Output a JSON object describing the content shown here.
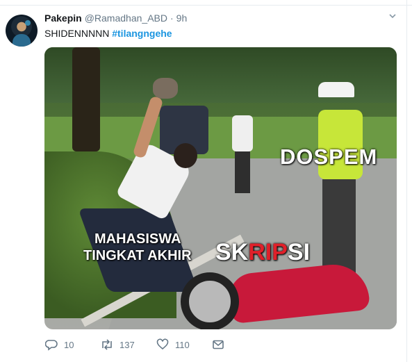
{
  "tweet": {
    "author": {
      "display_name": "Pakepin",
      "handle": "@Ramadhan_ABD",
      "separator": "·",
      "time": "9h"
    },
    "text_plain": "SHIDENNNNN",
    "hashtag": "#tilangngehe",
    "menu_icon": "chevron-down-icon"
  },
  "media": {
    "caption_dospem": "DOSPEM",
    "caption_mahasiswa_line1": "MAHASISWA",
    "caption_mahasiswa_line2": "TINGKAT AKHIR",
    "caption_skripsi_a": "SK",
    "caption_skripsi_b": "RIP",
    "caption_skripsi_c": "SI",
    "caption_colors": {
      "text": "#ffffff",
      "accent": "#e0202a"
    }
  },
  "actions": {
    "reply": {
      "icon": "reply-icon",
      "count": "10"
    },
    "retweet": {
      "icon": "retweet-icon",
      "count": "137"
    },
    "like": {
      "icon": "heart-icon",
      "count": "110"
    },
    "message": {
      "icon": "envelope-icon"
    }
  },
  "colors": {
    "link": "#1b95e0",
    "muted": "#657786",
    "text": "#14171a"
  }
}
